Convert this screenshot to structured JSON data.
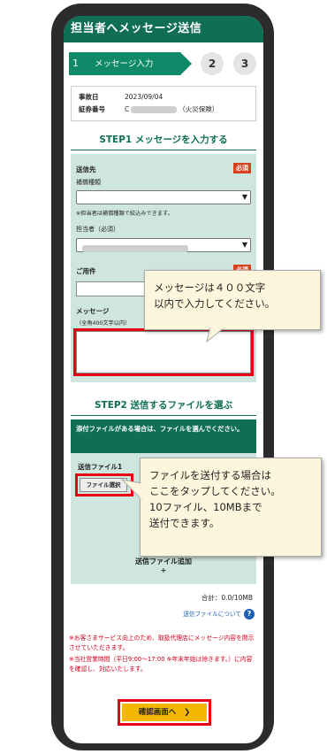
{
  "header": {
    "title": "担当者へメッセージ送信"
  },
  "steps": {
    "active_num": "1",
    "active_label": "メッセージ入力",
    "step2": "2",
    "step3": "3"
  },
  "info": {
    "date_label": "事故日",
    "date_value": "2023/09/04",
    "policy_label": "証券番号",
    "policy_prefix": "C",
    "policy_suffix": "（火災保険）"
  },
  "step1": {
    "heading": "STEP1 メッセージを入力する"
  },
  "form": {
    "to_label": "送信先",
    "required": "必須",
    "type_label": "補償種類",
    "type_note": "※担当者は補償種類で絞込みできます。",
    "person_label": "担当者（必須）",
    "subject_label": "ご用件",
    "subject_required": "必須",
    "message_label": "メッセージ",
    "message_note": "（全角400文字以内）"
  },
  "step2": {
    "heading": "STEP2 送信するファイルを選ぶ",
    "toggle_text": "添付ファイルがある場合は、ファイルを選んでください。",
    "file_label": "送信ファイル1",
    "file_button": "ファイル選択",
    "add_file": "送信ファイル追加",
    "add_plus": "+",
    "total": "合計：0.0/10MB",
    "about_link": "送信ファイルについて",
    "help": "?"
  },
  "notices": {
    "line1": "※お客さまサービス向上のため、取扱代理店にメッセージ内容を開示させていただきます。",
    "line2": "※当社営業時間（平日9:00〜17:00 ※年末年始は除きます。）に内容を確認し、対応いたします。"
  },
  "confirm": {
    "label": "確認画面へ",
    "arrow": "❯"
  },
  "callouts": {
    "msg_line1": "メッセージは４００文字",
    "msg_line2": "以内で入力してください。",
    "file_line1": "ファイルを送付する場合は",
    "file_line2": "ここをタップしてください。",
    "file_line3": "10ファイル、10MBまで",
    "file_line4": "送付できます。"
  },
  "colors": {
    "primary": "#0f6e54",
    "highlight": "#e60012",
    "button": "#f5b800",
    "callout_bg": "#fdf5dc"
  }
}
